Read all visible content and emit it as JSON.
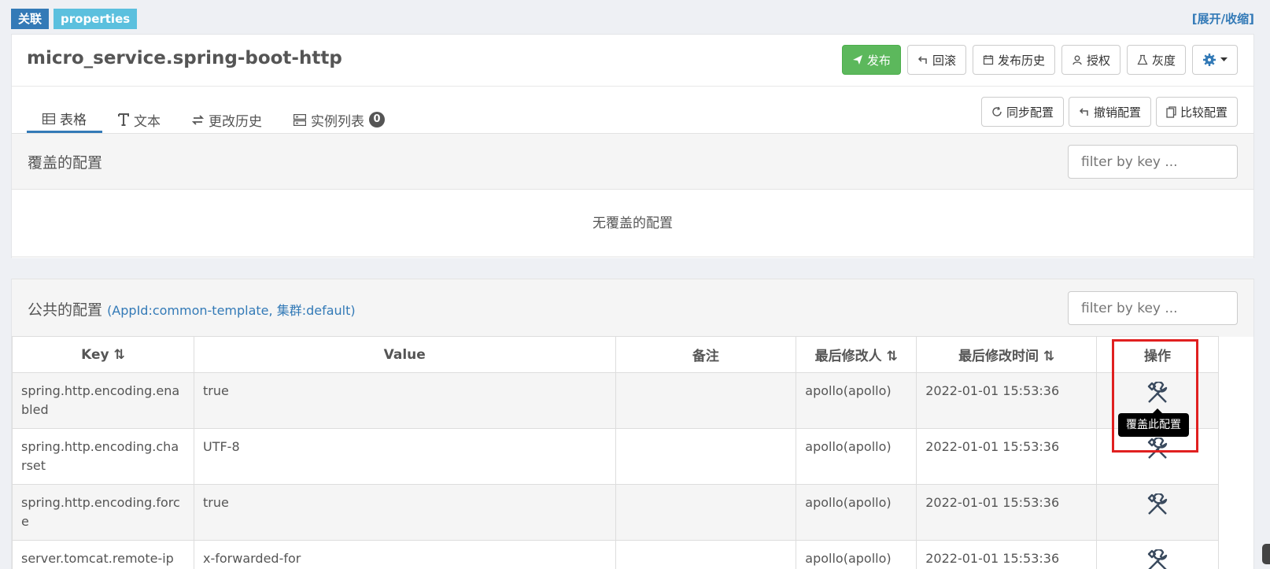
{
  "badges": {
    "link": "关联",
    "format": "properties"
  },
  "toggle": "[展开/收缩]",
  "namespace_title": "micro_service.spring-boot-http",
  "actions": {
    "publish": "发布",
    "rollback": "回滚",
    "history": "发布历史",
    "grant": "授权",
    "gray": "灰度"
  },
  "tabs": [
    {
      "label": "表格",
      "icon": "table-icon"
    },
    {
      "label": "文本",
      "icon": "text-icon"
    },
    {
      "label": "更改历史",
      "icon": "history-icon"
    },
    {
      "label": "实例列表",
      "icon": "server-icon",
      "count": "0"
    }
  ],
  "tab_actions": {
    "sync": "同步配置",
    "revoke": "撤销配置",
    "compare": "比较配置"
  },
  "override_section": {
    "title": "覆盖的配置",
    "filter_placeholder": "filter by key ...",
    "empty_text": "无覆盖的配置"
  },
  "public_section": {
    "title": "公共的配置",
    "subtitle": "(AppId:common-template, 集群:default)",
    "filter_placeholder": "filter by key ..."
  },
  "table": {
    "headers": {
      "key": "Key",
      "value": "Value",
      "comment": "备注",
      "modifier": "最后修改人",
      "modified_time": "最后修改时间",
      "operation": "操作"
    },
    "sort_glyph": "⇅",
    "rows": [
      {
        "key": "spring.http.encoding.ena bled",
        "value": "true",
        "comment": "",
        "modifier": "apollo(apollo)",
        "time": "2022-01-01 15:53:36"
      },
      {
        "key": "spring.http.encoding.cha rset",
        "value": "UTF-8",
        "comment": "",
        "modifier": "apollo(apollo)",
        "time": "2022-01-01 15:53:36"
      },
      {
        "key": "spring.http.encoding.forc e",
        "value": "true",
        "comment": "",
        "modifier": "apollo(apollo)",
        "time": "2022-01-01 15:53:36"
      },
      {
        "key": "server.tomcat.remote-ip",
        "value": "x-forwarded-for",
        "comment": "",
        "modifier": "apollo(apollo)",
        "time": "2022-01-01 15:53:36"
      }
    ]
  },
  "tooltip": "覆盖此配置",
  "colors": {
    "primary": "#337ab7",
    "success": "#5cb85c",
    "highlight": "#e02020"
  }
}
